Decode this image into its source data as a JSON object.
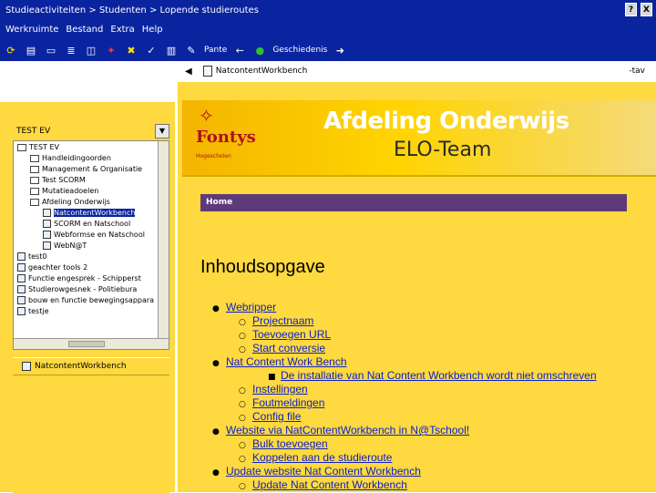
{
  "window": {
    "title": "Studieactiviteiten > Studenten > Lopende studieroutes",
    "buttons": [
      "?",
      "X"
    ]
  },
  "menu": [
    "Werkruimte",
    "Bestand",
    "Extra",
    "Help"
  ],
  "toolbar": {
    "rename_label": "Pante",
    "check_label": "Geschiedenis"
  },
  "navrow": {
    "path_label": "NatcontentWorkbench",
    "right_label": "-tav"
  },
  "tree": {
    "header": "TEST EV",
    "items": [
      {
        "label": "TEST EV",
        "level": 0,
        "type": "folder"
      },
      {
        "label": "Handleidingoorden",
        "level": 1,
        "type": "folder"
      },
      {
        "label": "Management & Organisatie",
        "level": 1,
        "type": "folder"
      },
      {
        "label": "Test SCORM",
        "level": 1,
        "type": "folder"
      },
      {
        "label": "Mutatieadoelen",
        "level": 1,
        "type": "folder"
      },
      {
        "label": "Afdeling Onderwijs",
        "level": 1,
        "type": "folder"
      },
      {
        "label": "NatcontentWorkbench",
        "level": 2,
        "type": "file",
        "selected": true
      },
      {
        "label": "SCORM en Natschool",
        "level": 2,
        "type": "file"
      },
      {
        "label": "Webformse en Natschool",
        "level": 2,
        "type": "file"
      },
      {
        "label": "WebN@T",
        "level": 2,
        "type": "file"
      },
      {
        "label": "test0",
        "level": 0,
        "type": "file"
      },
      {
        "label": "geachter tools 2",
        "level": 0,
        "type": "file"
      },
      {
        "label": "Functie engesprek - Schipperst",
        "level": 0,
        "type": "file"
      },
      {
        "label": "Studierowgesnek - Politiebura",
        "level": 0,
        "type": "file"
      },
      {
        "label": "bouw en functie bewegingsappara",
        "level": 0,
        "type": "file"
      },
      {
        "label": "testje",
        "level": 0,
        "type": "file"
      }
    ]
  },
  "bottom_pane": {
    "label": "NatcontentWorkbench"
  },
  "banner": {
    "logo": "Fontys",
    "logo_sub": "Hogescholen",
    "heading": "Afdeling Onderwijs",
    "subheading": "ELO-Team"
  },
  "breadcrumb_home": "Home",
  "page_title": "Inhoudsopgave",
  "toc": [
    {
      "label": "Webripper",
      "level": 1
    },
    {
      "label": "Projectnaam",
      "level": 2
    },
    {
      "label": "Toevoegen URL",
      "level": 2
    },
    {
      "label": "Start conversie",
      "level": 2
    },
    {
      "label": "Nat Content Work Bench",
      "level": 1
    },
    {
      "label": "De installatie van Nat Content Workbench wordt niet omschreven",
      "level": 3
    },
    {
      "label": "Instellingen",
      "level": 2
    },
    {
      "label": "Foutmeldingen",
      "level": 2
    },
    {
      "label": "Config file",
      "level": 2
    },
    {
      "label": "Website via NatContentWorkbench in N@Tschool!",
      "level": 1
    },
    {
      "label": "Bulk toevoegen",
      "level": 2
    },
    {
      "label": "Koppelen aan de studieroute",
      "level": 2
    },
    {
      "label": "Update website Nat Content Workbench",
      "level": 1
    },
    {
      "label": "Update Nat Content Workbench",
      "level": 2
    }
  ],
  "colors": {
    "chrome_blue": "#0a24a0",
    "pane_yellow": "#fed93f",
    "home_bar": "#5f3a7a",
    "link": "#0d21cc"
  }
}
